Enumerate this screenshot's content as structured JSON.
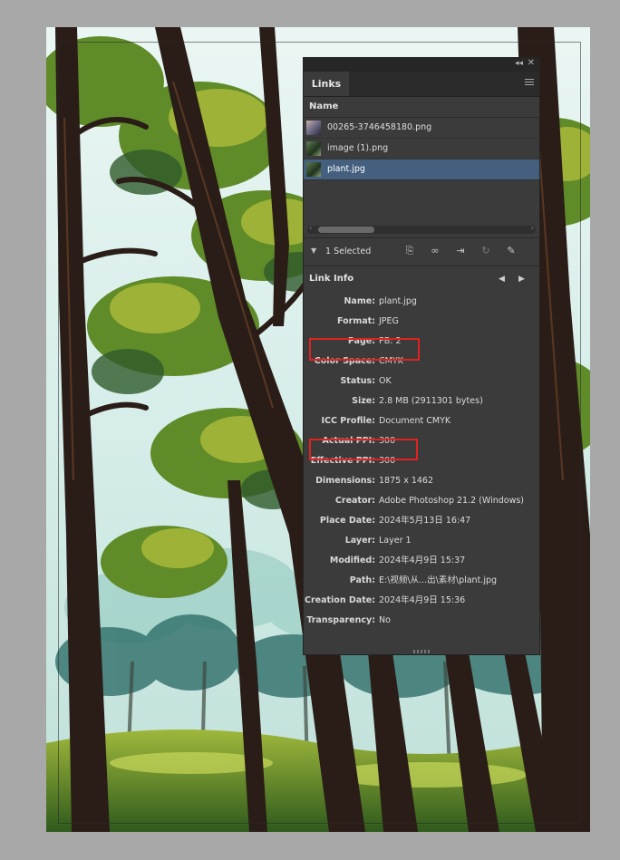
{
  "panel": {
    "tab_label": "Links",
    "column_header": "Name",
    "files": [
      {
        "name": "00265-3746458180.png",
        "selected": false
      },
      {
        "name": "image (1).png",
        "selected": false
      },
      {
        "name": "plant.jpg",
        "selected": true
      }
    ],
    "selection_status": "1 Selected",
    "toolbar_icons": [
      "relink-from-cc-icon",
      "link-icon",
      "goto-link-icon",
      "update-link-icon",
      "edit-original-icon"
    ]
  },
  "link_info": {
    "title": "Link Info",
    "rows": [
      {
        "label": "Name:",
        "value": "plant.jpg"
      },
      {
        "label": "Format:",
        "value": "JPEG"
      },
      {
        "label": "Page:",
        "value": "PB: 2"
      },
      {
        "label": "Color Space:",
        "value": "CMYK"
      },
      {
        "label": "Status:",
        "value": "OK"
      },
      {
        "label": "Size:",
        "value": "2.8 MB (2911301 bytes)"
      },
      {
        "label": "ICC Profile:",
        "value": "Document CMYK"
      },
      {
        "label": "Actual PPI:",
        "value": "300"
      },
      {
        "label": "Effective PPI:",
        "value": "300"
      },
      {
        "label": "Dimensions:",
        "value": "1875 x 1462"
      },
      {
        "label": "Creator:",
        "value": "Adobe Photoshop 21.2 (Windows)"
      },
      {
        "label": "Place Date:",
        "value": "2024年5月13日 16:47"
      },
      {
        "label": "Layer:",
        "value": "Layer 1"
      },
      {
        "label": "Modified:",
        "value": "2024年4月9日 15:37"
      },
      {
        "label": "Path:",
        "value": "E:\\视频\\从...出\\素材\\plant.jpg"
      },
      {
        "label": "Creation Date:",
        "value": "2024年4月9日 15:36"
      },
      {
        "label": "Transparency:",
        "value": "No"
      }
    ]
  },
  "colors": {
    "panel_bg": "#3b3b3b",
    "selection": "#44607e",
    "highlight_box": "#e0231f"
  }
}
